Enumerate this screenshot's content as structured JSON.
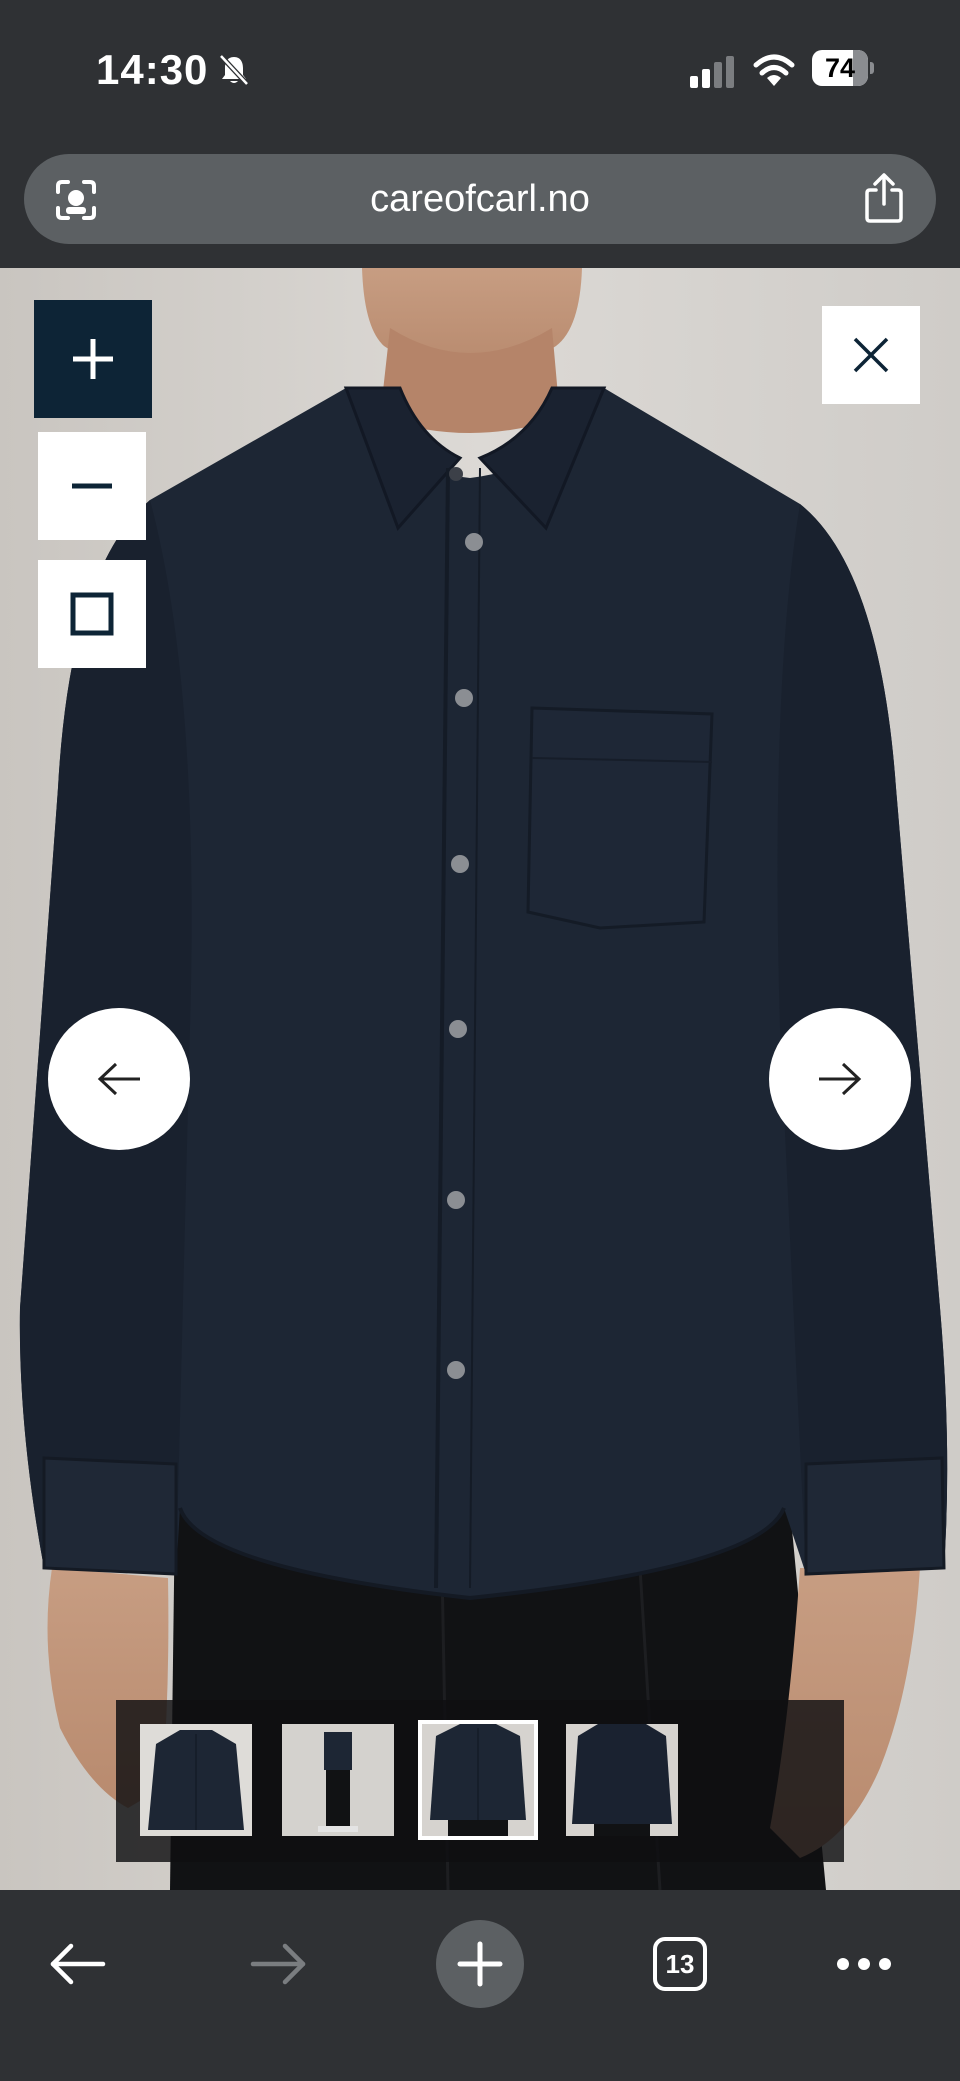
{
  "status_bar": {
    "time": "14:30",
    "battery_level": "74",
    "battery_fraction": 0.74,
    "icons": [
      "bell-slash-icon",
      "cellular-signal-icon",
      "wifi-icon",
      "battery-icon"
    ]
  },
  "browser": {
    "url": "careofcarl.no",
    "icons": [
      "lens-icon",
      "share-icon"
    ]
  },
  "viewer": {
    "controls": [
      "zoom-in-icon",
      "zoom-out-icon",
      "fit-screen-icon",
      "close-icon",
      "arrow-left-icon",
      "arrow-right-icon"
    ],
    "thumbnail_count": 4,
    "active_thumbnail": 3,
    "colors": {
      "zoom_in_bg": "#0d2436",
      "shirt": "#1d2634",
      "background": "#d9d6d2"
    }
  },
  "toolbar": {
    "tab_count": "13",
    "icons": [
      "back-arrow-icon",
      "forward-arrow-icon",
      "new-tab-plus-icon",
      "tabs-icon",
      "more-icon"
    ]
  }
}
